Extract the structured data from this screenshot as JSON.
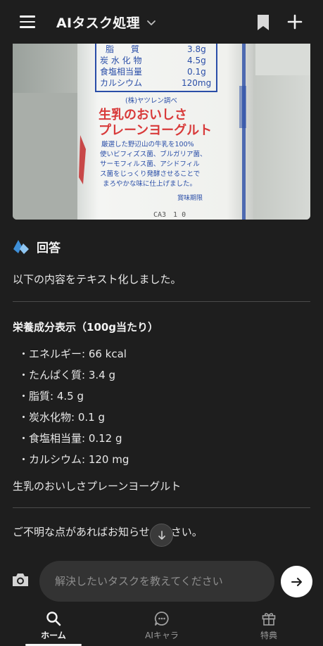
{
  "header": {
    "title": "AIタスク処理"
  },
  "photo": {
    "label_rows": [
      {
        "name": "脂　　質",
        "value": "3.8g"
      },
      {
        "name": "炭 水 化 物",
        "value": "4.5g"
      },
      {
        "name": "食塩相当量",
        "value": "0.1g"
      },
      {
        "name": "カルシウム",
        "value": "120mg"
      }
    ],
    "maker": "(株)ヤツレン調べ",
    "product_line1": "生乳のおいしさ",
    "product_line2": "プレーンヨーグルト",
    "desc_lines": [
      "厳選した野辺山の牛乳を100%",
      "使いビフィズス菌、ブルガリア菌、",
      "サーモフィルス菌、アシドフィル",
      "ス菌をじっくり発酵させることで",
      "まろやかな味に仕上げました。"
    ],
    "expiry": "賞味期限",
    "code": "CA3　1 0"
  },
  "answer": {
    "heading": "回答",
    "intro": "以下の内容をテキスト化しました。",
    "section_heading": "栄養成分表示（100g当たり）",
    "items": [
      "・エネルギー: 66 kcal",
      "・たんぱく質: 3.4 g",
      "・脂質: 4.5 g",
      "・炭水化物: 0.1 g",
      "・食塩相当量: 0.12 g",
      "・カルシウム: 120 mg"
    ],
    "product_name": "生乳のおいしさプレーンヨーグルト",
    "closing": "ご不明な点があればお知らせください。"
  },
  "input": {
    "placeholder": "解決したいタスクを教えてください"
  },
  "nav": {
    "home": "ホーム",
    "chara": "AIキャラ",
    "gift": "特典"
  },
  "colors": {
    "background": "#1e1e1e",
    "accent_blue": "#4a9be0",
    "label_blue": "#2a4ea8",
    "label_red": "#d83a3a"
  }
}
